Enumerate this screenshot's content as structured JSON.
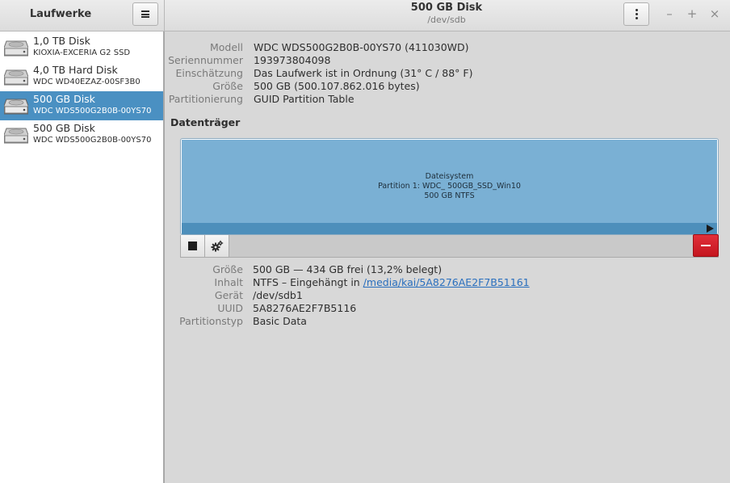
{
  "sidebar": {
    "title": "Laufwerke",
    "drives": [
      {
        "name": "1,0 TB Disk",
        "model": "KIOXIA-EXCERIA G2 SSD"
      },
      {
        "name": "4,0 TB Hard Disk",
        "model": "WDC WD40EZAZ-00SF3B0"
      },
      {
        "name": "500 GB Disk",
        "model": "WDC  WDS500G2B0B-00YS70"
      },
      {
        "name": "500 GB Disk",
        "model": "WDC  WDS500G2B0B-00YS70"
      }
    ]
  },
  "header": {
    "title": "500 GB Disk",
    "subtitle": "/dev/sdb"
  },
  "window_controls": {
    "minimize": "–",
    "maximize": "+",
    "close": "×"
  },
  "disk": {
    "rows": [
      {
        "label": "Modell",
        "value": "WDC  WDS500G2B0B-00YS70 (411030WD)"
      },
      {
        "label": "Seriennummer",
        "value": "193973804098"
      },
      {
        "label": "Einschätzung",
        "value": "Das Laufwerk ist in Ordnung (31° C / 88° F)"
      },
      {
        "label": "Größe",
        "value": "500 GB (500.107.862.016 bytes)"
      },
      {
        "label": "Partitionierung",
        "value": "GUID Partition Table"
      }
    ]
  },
  "volumes": {
    "title": "Datenträger",
    "partition": {
      "line1": "Dateisystem",
      "line2": "Partition 1: WDC_ 500GB_SSD_Win10",
      "line3": "500 GB NTFS"
    }
  },
  "partition_details": {
    "size": {
      "label": "Größe",
      "value": "500 GB — 434 GB frei (13,2% belegt)"
    },
    "content": {
      "label": "Inhalt",
      "value_prefix": "NTFS – Eingehängt in ",
      "link": "/media/kai/5A8276AE2F7B51161"
    },
    "device": {
      "label": "Gerät",
      "value": "/dev/sdb1"
    },
    "uuid": {
      "label": "UUID",
      "value": "5A8276AE2F7B5116"
    },
    "type": {
      "label": "Partitionstyp",
      "value": "Basic Data"
    }
  },
  "colors": {
    "selection": "#4a90c2",
    "partition": "#7ab0d4",
    "delete": "#d4202a",
    "link": "#2a6fbe"
  }
}
